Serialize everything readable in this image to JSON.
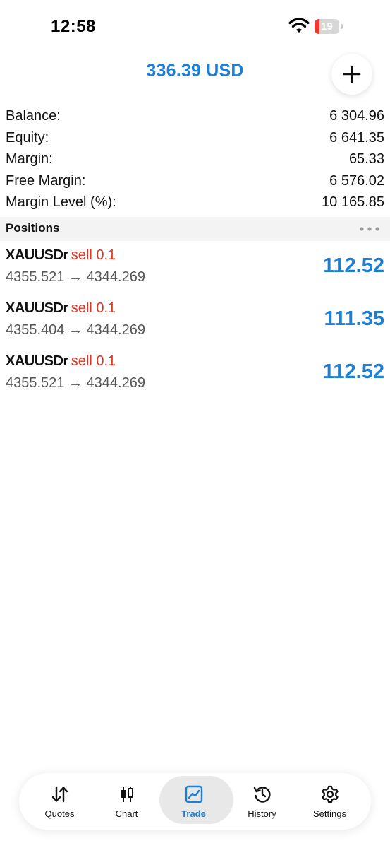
{
  "status_bar": {
    "time": "12:58",
    "battery_level": "19"
  },
  "header": {
    "profit": "336.39 USD",
    "add_icon": "plus-icon"
  },
  "account": [
    {
      "label": "Balance:",
      "value": "6 304.96"
    },
    {
      "label": "Equity:",
      "value": "6 641.35"
    },
    {
      "label": "Margin:",
      "value": "65.33"
    },
    {
      "label": "Free Margin:",
      "value": "6 576.02"
    },
    {
      "label": "Margin Level (%):",
      "value": "10 165.85"
    }
  ],
  "positions": {
    "title": "Positions",
    "items": [
      {
        "symbol": "XAUUSDr",
        "action": "sell 0.1",
        "prices": "4355.521 → 4344.269",
        "profit": "112.52"
      },
      {
        "symbol": "XAUUSDr",
        "action": "sell 0.1",
        "prices": "4355.404 → 4344.269",
        "profit": "111.35"
      },
      {
        "symbol": "XAUUSDr",
        "action": "sell 0.1",
        "prices": "4355.521 → 4344.269",
        "profit": "112.52"
      }
    ]
  },
  "tabs": [
    {
      "label": "Quotes",
      "icon": "quotes-icon"
    },
    {
      "label": "Chart",
      "icon": "chart-candles-icon"
    },
    {
      "label": "Trade",
      "icon": "trade-icon",
      "active": true
    },
    {
      "label": "History",
      "icon": "history-icon"
    },
    {
      "label": "Settings",
      "icon": "gear-icon"
    }
  ],
  "colors": {
    "accent": "#1e7fd6",
    "sell": "#e0341f",
    "battery_low": "#ea3a30"
  }
}
